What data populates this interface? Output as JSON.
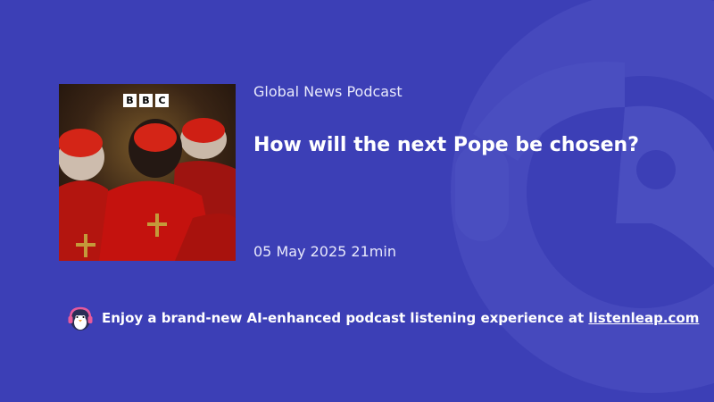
{
  "podcast": {
    "name": "Global News Podcast",
    "cover_logo_letters": [
      "B",
      "B",
      "C"
    ]
  },
  "episode": {
    "title": "How will the next Pope be chosen?",
    "date": "05 May 2025",
    "duration": "21min"
  },
  "promo": {
    "text": "Enjoy a brand-new AI-enhanced podcast listening experience at",
    "link_text": "listenleap.com",
    "icon": "penguin-headphones-icon"
  },
  "colors": {
    "background": "#3c3fb6",
    "watermark": "#4a4ec0",
    "robe_red": "#c4120e"
  }
}
